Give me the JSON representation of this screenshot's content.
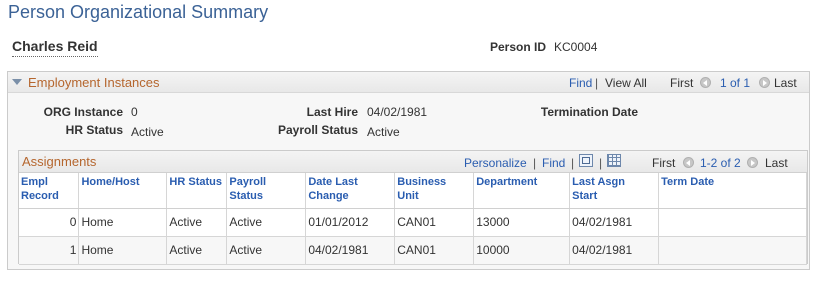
{
  "page": {
    "title": "Person Organizational Summary",
    "person_name": "Charles Reid",
    "person_id_label": "Person ID",
    "person_id_value": "KC0004"
  },
  "employment": {
    "title": "Employment Instances",
    "find_label": "Find",
    "separator": "|",
    "view_all_label": "View All",
    "first_label": "First",
    "page_count": "1 of 1",
    "last_label": "Last",
    "fields": {
      "org_instance_label": "ORG Instance",
      "org_instance_value": "0",
      "hr_status_label": "HR Status",
      "hr_status_value": "Active",
      "last_hire_label": "Last Hire",
      "last_hire_value": "04/02/1981",
      "payroll_status_label": "Payroll Status",
      "payroll_status_value": "Active",
      "termination_date_label": "Termination Date",
      "termination_date_value": ""
    }
  },
  "assignments": {
    "title": "Assignments",
    "personalize_label": "Personalize",
    "find_label": "Find",
    "separator": "|",
    "first_label": "First",
    "page_count": "1-2 of 2",
    "last_label": "Last",
    "columns": [
      [
        "Empl",
        "Record"
      ],
      [
        "Home/Host",
        ""
      ],
      [
        "HR Status",
        ""
      ],
      [
        "Payroll",
        "Status"
      ],
      [
        "Date Last",
        "Change"
      ],
      [
        "Business",
        "Unit"
      ],
      [
        "Department",
        ""
      ],
      [
        "Last Asgn",
        "Start"
      ],
      [
        "Term Date",
        ""
      ]
    ],
    "rows": [
      [
        "0",
        "Home",
        "Active",
        "Active",
        "01/01/2012",
        "CAN01",
        "13000",
        "04/02/1981",
        ""
      ],
      [
        "1",
        "Home",
        "Active",
        "Active",
        "04/02/1981",
        "CAN01",
        "10000",
        "04/02/1981",
        ""
      ]
    ]
  },
  "icons": {
    "collapse": "triangle-down-icon",
    "prev": "previous-arrow-icon",
    "next": "next-arrow-icon",
    "view_all_grid": "view-all-icon",
    "download": "download-grid-icon"
  },
  "colors": {
    "title_blue": "#3b6296",
    "section_orange": "#b5662e",
    "link_blue": "#2a5db0"
  }
}
